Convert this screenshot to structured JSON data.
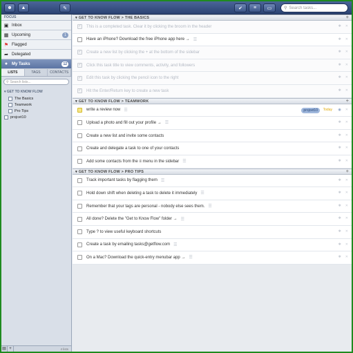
{
  "toolbar": {
    "search_placeholder": "Search tasks..."
  },
  "sidebar": {
    "focus_label": "FOCUS",
    "items": [
      {
        "label": "Inbox",
        "count": ""
      },
      {
        "label": "Upcoming",
        "count": "1"
      },
      {
        "label": "Flagged",
        "count": ""
      },
      {
        "label": "Delegated",
        "count": ""
      },
      {
        "label": "My Tasks",
        "count": "12"
      }
    ],
    "tabs": [
      "LISTS",
      "TAGS",
      "CONTACTS"
    ],
    "search_placeholder": "Search lists...",
    "group_label": "GET TO KNOW FLOW",
    "lists": [
      "The Basics",
      "Teamwork",
      "Pro Tips"
    ],
    "root_list": "projcet10",
    "list_count": "4 lists"
  },
  "main": {
    "sections": [
      {
        "title": "GET TO KNOW FLOW  >  THE BASICS",
        "tasks": [
          {
            "text": "This is a completed task. Clear it by clicking the broom in the header",
            "done": true
          },
          {
            "text": "Have an iPhone? Download the free iPhone app here →",
            "done": false
          },
          {
            "text": "Create a new list by clicking the + at the bottom of the sidebar",
            "done": true
          },
          {
            "text": "Click this task title to view comments, activity, and followers",
            "done": true
          },
          {
            "text": "Edit this task by clicking the pencil icon to the right",
            "done": true
          },
          {
            "text": "Hit the Enter/Return key to create a new task",
            "done": true
          }
        ]
      },
      {
        "title": "GET TO KNOW FLOW  >  TEAMWORK",
        "tasks": [
          {
            "text": "write a review now",
            "done": false,
            "tag": "projcet10",
            "due": "Today"
          },
          {
            "text": "Upload a photo and fill out your profile →",
            "done": false
          },
          {
            "text": "Create a new list and invite some contacts",
            "done": false
          },
          {
            "text": "Create and delegate a task to one of your contacts",
            "done": false
          },
          {
            "text": "Add some contacts from the ≡ menu in the sidebar",
            "done": false
          }
        ]
      },
      {
        "title": "GET TO KNOW FLOW  >  PRO TIPS",
        "tasks": [
          {
            "text": "Track important tasks by flagging them",
            "done": false
          },
          {
            "text": "Hold down shift when deleting a task to delete it immediately",
            "done": false
          },
          {
            "text": "Remember that your tags are personal - nobody else sees them.",
            "done": false
          },
          {
            "text": "All done? Delete the \"Get to Know Flow\" folder →",
            "done": false
          },
          {
            "text": "Type ? to view useful keyboard shortcuts",
            "done": false
          },
          {
            "text": "Create a task by emailing tasks@getflow.com",
            "done": false
          },
          {
            "text": "On a Mac? Download the quick-entry menubar app →",
            "done": false
          }
        ]
      }
    ]
  }
}
